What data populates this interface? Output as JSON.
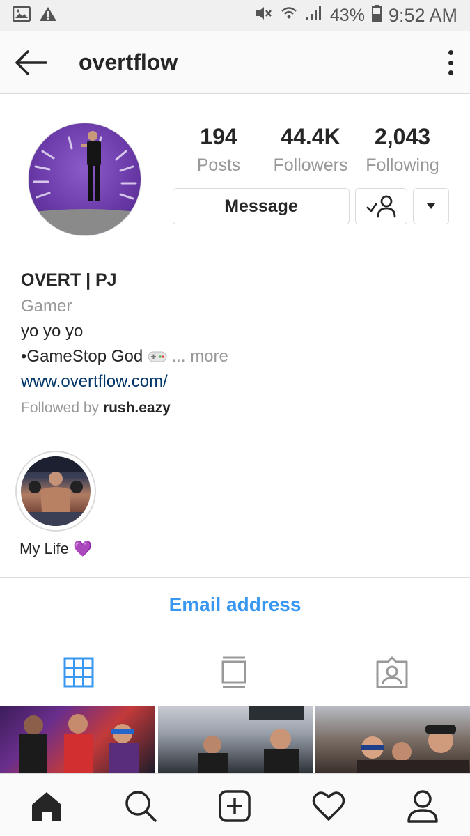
{
  "status_bar": {
    "battery_percent": "43%",
    "time": "9:52 AM"
  },
  "header": {
    "title": "overtflow"
  },
  "profile": {
    "stats": {
      "posts_count": "194",
      "posts_label": "Posts",
      "followers_count": "44.4K",
      "followers_label": "Followers",
      "following_count": "2,043",
      "following_label": "Following"
    },
    "message_label": "Message"
  },
  "bio": {
    "name": "OVERT | PJ",
    "category": "Gamer",
    "line1": "yo yo yo",
    "line2": "•GameStop God",
    "more": "... more",
    "website": "www.overtflow.com/",
    "followed_by_prefix": "Followed by ",
    "followed_by_user": "rush.eazy"
  },
  "highlights": [
    {
      "label": "My Life 💜"
    }
  ],
  "contact": {
    "email_label": "Email address"
  },
  "icons": {
    "status_left": [
      "image-icon",
      "warning-icon"
    ],
    "status_right": [
      "mute-icon",
      "wifi-icon",
      "signal-icon",
      "battery-icon"
    ],
    "tabs": [
      "grid-icon",
      "feed-icon",
      "tagged-icon"
    ],
    "nav": [
      "home-icon",
      "search-icon",
      "add-icon",
      "heart-icon",
      "profile-icon"
    ]
  },
  "colors": {
    "accent_blue": "#3897f0",
    "link_blue": "#003569",
    "text": "#262626",
    "muted": "#999999"
  }
}
